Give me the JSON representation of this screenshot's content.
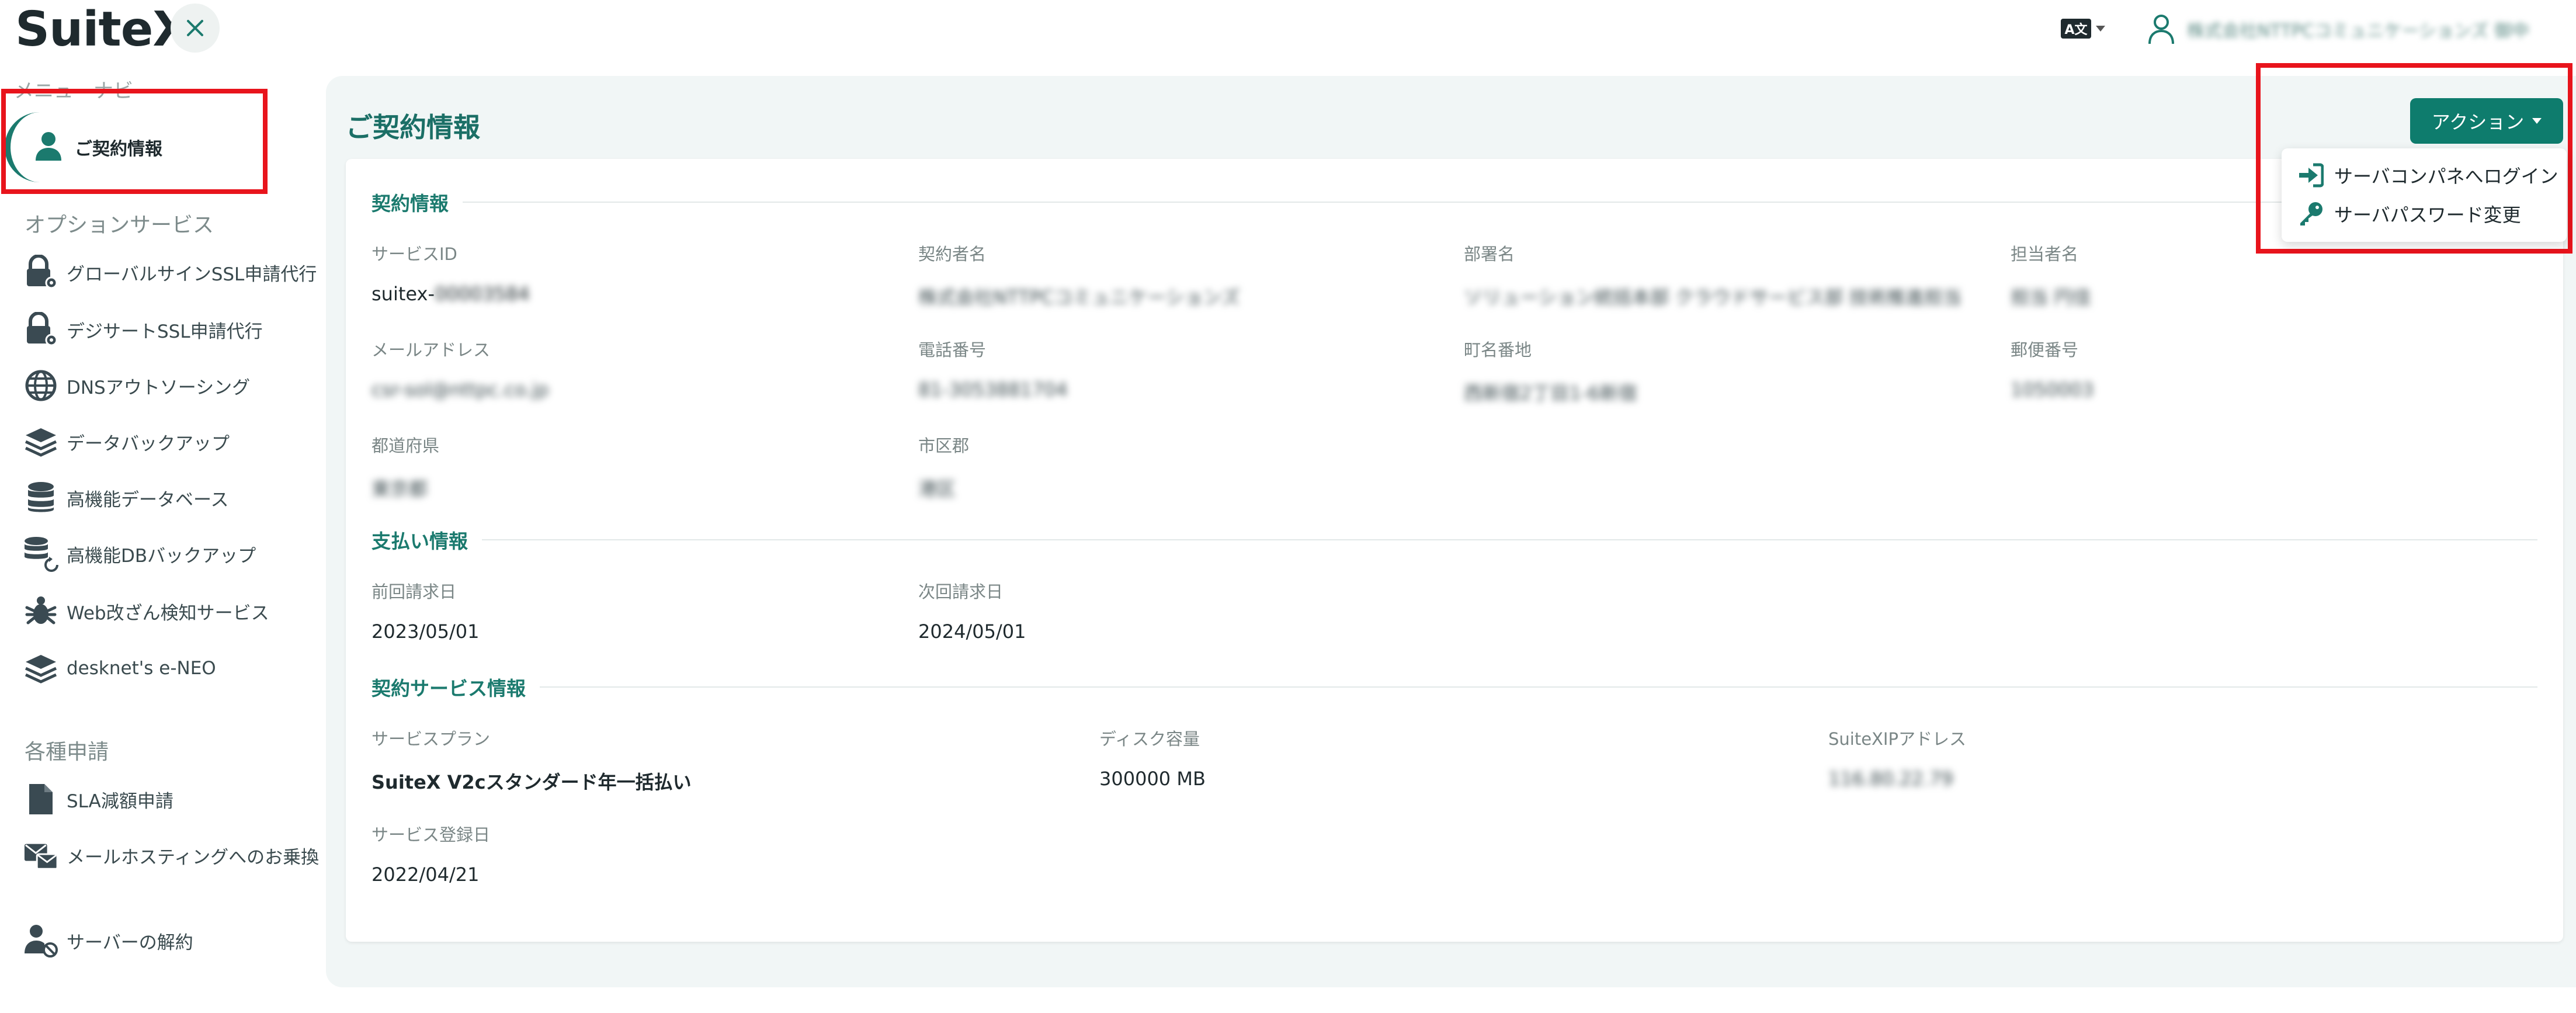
{
  "header": {
    "logo": "SuiteX",
    "user_name": "株式会社NTTPCコミュニケーションズ 御中"
  },
  "sidebar": {
    "menu_label": "メニューナビ",
    "active_item": {
      "label": "ご契約情報"
    },
    "option_services_title": "オプションサービス",
    "option_items": [
      {
        "label": "グローバルサインSSL申請代行",
        "icon": "lock-gear-icon"
      },
      {
        "label": "デジサートSSL申請代行",
        "icon": "lock-gear-icon"
      },
      {
        "label": "DNSアウトソーシング",
        "icon": "globe-icon"
      },
      {
        "label": "データバックアップ",
        "icon": "layers-icon"
      },
      {
        "label": "高機能データベース",
        "icon": "database-icon"
      },
      {
        "label": "高機能DBバックアップ",
        "icon": "database-restore-icon"
      },
      {
        "label": "Web改ざん検知サービス",
        "icon": "bug-icon"
      },
      {
        "label": "desknet's e-NEO",
        "icon": "layers-icon"
      }
    ],
    "requests_title": "各種申請",
    "request_items": [
      {
        "label": "SLA減額申請",
        "icon": "file-icon"
      },
      {
        "label": "メールホスティングへのお乗換",
        "icon": "mail-transfer-icon"
      }
    ],
    "cancel_item": {
      "label": "サーバーの解約",
      "icon": "user-cancel-icon"
    }
  },
  "main": {
    "page_title": "ご契約情報",
    "action_button": "アクション",
    "dropdown": [
      {
        "label": "サーバコンパネへログイン",
        "icon": "login-icon"
      },
      {
        "label": "サーバパスワード変更",
        "icon": "key-icon"
      }
    ],
    "contract": {
      "title": "契約情報",
      "service_id_label": "サービスID",
      "service_id_prefix": "suitex-",
      "service_id_hidden": "00003584",
      "contractor_label": "契約者名",
      "contractor": "株式会社NTTPCコミュニケーションズ",
      "department_label": "部署名",
      "department": "ソリューション統括本部 クラウドサービス部 技術推進担当",
      "person_label": "担当者名",
      "person": "担当 円佳",
      "email_label": "メールアドレス",
      "email": "csr-sol@nttpc.co.jp",
      "phone_label": "電話番号",
      "phone": "81-3053881704",
      "address_label": "町名番地",
      "address": "西新宿2丁目1-6新宿",
      "postal_label": "郵便番号",
      "postal": "1050003",
      "prefecture_label": "都道府県",
      "prefecture": "東京都",
      "city_label": "市区郡",
      "city": "港区"
    },
    "payment": {
      "title": "支払い情報",
      "last_billing_label": "前回請求日",
      "last_billing": "2023/05/01",
      "next_billing_label": "次回請求日",
      "next_billing": "2024/05/01"
    },
    "service": {
      "title": "契約サービス情報",
      "plan_label": "サービスプラン",
      "plan": "SuiteX V2cスタンダード年一括払い",
      "disk_label": "ディスク容量",
      "disk": "300000 MB",
      "ip_label": "SuiteXIPアドレス",
      "ip": "116.80.22.79",
      "registered_label": "サービス登録日",
      "registered": "2022/04/21"
    }
  },
  "colors": {
    "accent": "#0e7c6d",
    "title_green": "#1b6f66",
    "highlight_red": "#e8141c",
    "main_bg": "#f1f6f6"
  }
}
